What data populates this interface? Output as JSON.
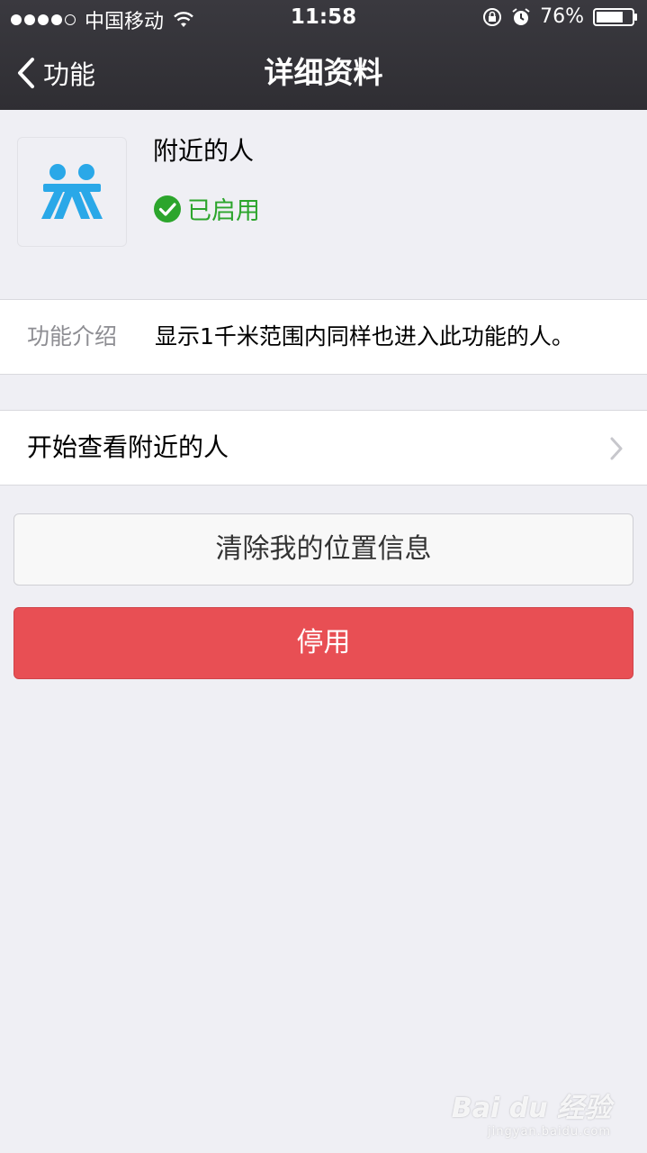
{
  "status_bar": {
    "carrier": "中国移动",
    "time": "11:58",
    "battery_percent": "76%",
    "battery_level": 0.76,
    "signal_bars": 4,
    "signal_max": 5
  },
  "nav": {
    "back_label": "功能",
    "title": "详细资料"
  },
  "feature": {
    "name": "附近的人",
    "status": "已启用",
    "icon": "people-nearby-icon",
    "icon_color": "#2aa8e8",
    "status_color": "#2ca52c"
  },
  "intro": {
    "label": "功能介绍",
    "text": "显示1千米范围内同样也进入此功能的人。"
  },
  "start_row": {
    "label": "开始查看附近的人"
  },
  "buttons": {
    "clear_label": "清除我的位置信息",
    "disable_label": "停用",
    "disable_color": "#e84f54"
  },
  "watermark": {
    "main": "Bai du 经验",
    "sub": "jingyan.baidu.com"
  }
}
